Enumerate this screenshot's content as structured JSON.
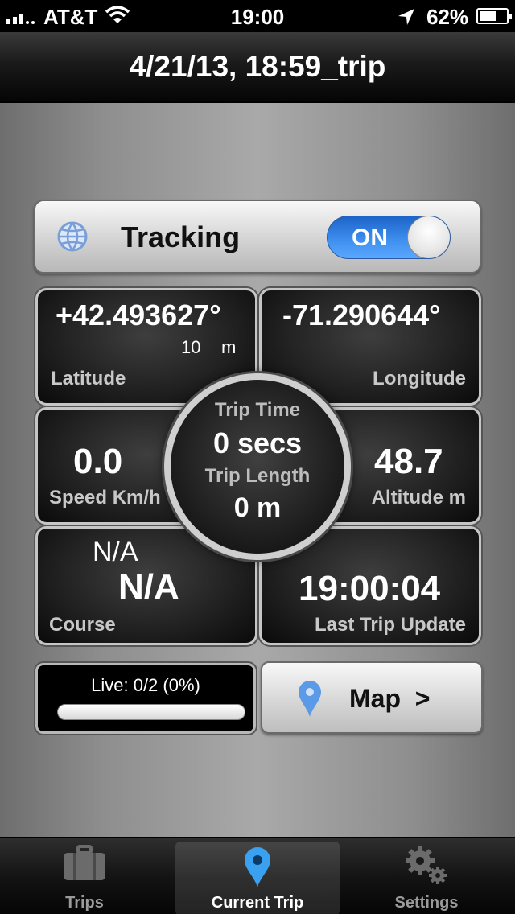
{
  "status_bar": {
    "carrier": "AT&T",
    "time": "19:00",
    "battery": "62%",
    "battery_level": 0.62,
    "icons": [
      "signal-icon",
      "wifi-icon",
      "location-arrow-icon",
      "battery-icon"
    ]
  },
  "nav": {
    "title": "4/21/13, 18:59_trip"
  },
  "tracking": {
    "label": "Tracking",
    "switch_label": "ON",
    "state": true,
    "icon": "globe-icon"
  },
  "latitude": {
    "value": "+42.493627°",
    "accuracy": "10",
    "accuracy_unit": "m",
    "label": "Latitude"
  },
  "longitude": {
    "value": "-71.290644°",
    "label": "Longitude"
  },
  "speed": {
    "value": "0.0",
    "label": "Speed Km/h"
  },
  "altitude": {
    "value": "48.7",
    "label": "Altitude m"
  },
  "course": {
    "value_small": "N/A",
    "value": "N/A",
    "label": "Course"
  },
  "last_update": {
    "value": "19:00:04",
    "label": "Last Trip Update"
  },
  "trip": {
    "time_label": "Trip Time",
    "time_value": "0 secs",
    "length_label": "Trip Length",
    "length_value": "0 m"
  },
  "live": {
    "text": "Live: 0/2 (0%)",
    "progress": 0
  },
  "map_button": {
    "label": "Map",
    "chevron": ">",
    "icon": "map-pin-icon"
  },
  "tabs": [
    {
      "label": "Trips",
      "icon": "briefcase-icon",
      "active": false
    },
    {
      "label": "Current Trip",
      "icon": "map-pin-icon",
      "active": true
    },
    {
      "label": "Settings",
      "icon": "gears-icon",
      "active": false
    }
  ],
  "colors": {
    "accent": "#3d8eee",
    "pin": "#5a9ae6"
  }
}
